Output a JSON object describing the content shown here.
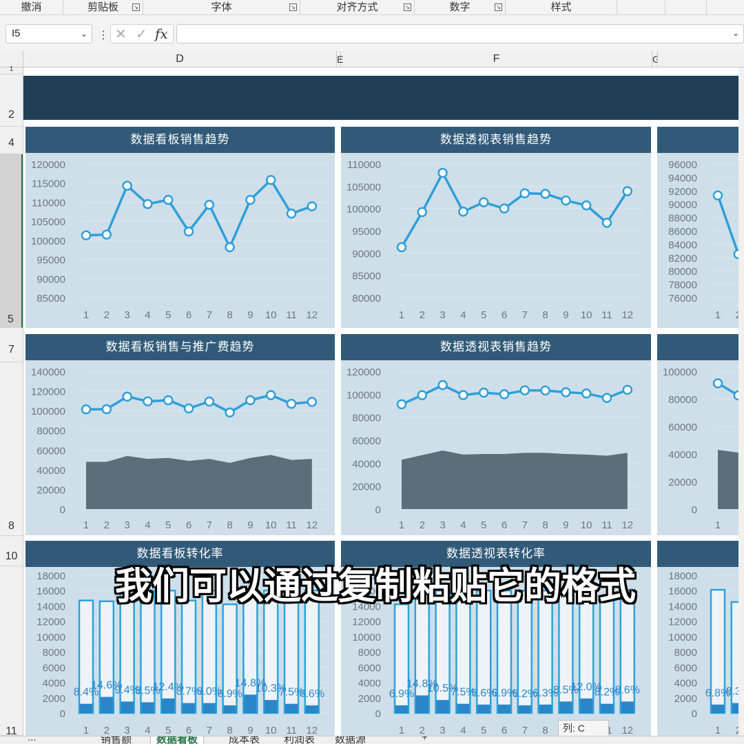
{
  "ribbon": {
    "groups": [
      {
        "label": "撤消",
        "launcher": false
      },
      {
        "label": "剪贴板",
        "launcher": true
      },
      {
        "label": "字体",
        "launcher": true
      },
      {
        "label": "对齐方式",
        "launcher": true
      },
      {
        "label": "数字",
        "launcher": true
      },
      {
        "label": "样式",
        "launcher": false
      }
    ]
  },
  "formula_bar": {
    "name_box": "I5",
    "cancel_icon": "✕",
    "enter_icon": "✓",
    "fx_label": "fx",
    "formula": ""
  },
  "columns": [
    "D",
    "E",
    "F",
    "G"
  ],
  "rows": [
    "1",
    "2",
    "4",
    "5",
    "7",
    "8",
    "10",
    "11"
  ],
  "caption": "我们可以通过复制粘贴它的格式",
  "tooltip": "列: C",
  "sheet_tabs": [
    "...",
    "销售额",
    "数据看板",
    "成本表",
    "利润表",
    "数据源",
    "+"
  ],
  "colors": {
    "banner": "#213f57",
    "panel_title_bg": "#305a78",
    "panel_bg": "#cfdfea",
    "line": "#2e9fd8",
    "area": "#5c6e7a",
    "bar": "#2b86c8"
  },
  "chart_data": [
    {
      "type": "line",
      "title": "数据看板销售趋势",
      "x": [
        1,
        2,
        3,
        4,
        5,
        6,
        7,
        8,
        9,
        10,
        11,
        12
      ],
      "values": [
        101300,
        101500,
        114300,
        109500,
        110600,
        102300,
        109300,
        98200,
        110600,
        115800,
        107000,
        108900
      ],
      "ylim": [
        85000,
        120000
      ],
      "yticks": [
        120000,
        115000,
        110000,
        105000,
        100000,
        95000,
        90000,
        85000
      ]
    },
    {
      "type": "line",
      "title": "数据透视表销售趋势",
      "x": [
        1,
        2,
        3,
        4,
        5,
        6,
        7,
        8,
        9,
        10,
        11,
        12
      ],
      "values": [
        91300,
        99200,
        108000,
        99300,
        101400,
        100000,
        103400,
        103300,
        101800,
        100700,
        96800,
        103900
      ],
      "ylim": [
        80000,
        110000
      ],
      "yticks": [
        110000,
        105000,
        100000,
        95000,
        90000,
        85000,
        80000
      ]
    },
    {
      "type": "line",
      "title": "",
      "x": [
        1,
        2
      ],
      "values": [
        91300,
        82500
      ],
      "ylim": [
        76000,
        96000
      ],
      "yticks": [
        96000,
        94000,
        92000,
        90000,
        88000,
        86000,
        84000,
        82000,
        80000,
        78000,
        76000
      ]
    },
    {
      "type": "line",
      "title": "数据看板销售与推广费趋势",
      "x": [
        1,
        2,
        3,
        4,
        5,
        6,
        7,
        8,
        9,
        10,
        11,
        12
      ],
      "series": [
        {
          "type": "line",
          "values": [
            101300,
            101500,
            114300,
            109500,
            110600,
            102300,
            109300,
            98200,
            110600,
            115800,
            107000,
            108900
          ]
        },
        {
          "type": "area",
          "values": [
            48000,
            48000,
            54000,
            51000,
            52000,
            49000,
            51000,
            47000,
            52000,
            55000,
            50000,
            51000
          ]
        }
      ],
      "ylim": [
        0,
        140000
      ],
      "yticks": [
        140000,
        120000,
        100000,
        80000,
        60000,
        40000,
        20000,
        0
      ]
    },
    {
      "type": "line",
      "title": "数据透视表销售趋势",
      "x": [
        1,
        2,
        3,
        4,
        5,
        6,
        7,
        8,
        9,
        10,
        11,
        12
      ],
      "series": [
        {
          "type": "line",
          "values": [
            91300,
            99200,
            108000,
            99300,
            101400,
            100000,
            103400,
            103300,
            101800,
            100700,
            96800,
            103900
          ]
        },
        {
          "type": "area",
          "values": [
            43000,
            47000,
            51000,
            47500,
            48000,
            48000,
            49000,
            49000,
            48000,
            47500,
            46500,
            49000
          ]
        }
      ],
      "ylim": [
        0,
        120000
      ],
      "yticks": [
        120000,
        100000,
        80000,
        60000,
        40000,
        20000,
        0
      ]
    },
    {
      "type": "line",
      "title": "",
      "x": [
        1
      ],
      "series": [
        {
          "type": "line",
          "values": [
            91300,
            82500
          ]
        },
        {
          "type": "area",
          "values": [
            43000,
            41000
          ]
        }
      ],
      "ylim": [
        0,
        100000
      ],
      "yticks": [
        100000,
        80000,
        60000,
        40000,
        20000,
        0
      ]
    },
    {
      "type": "bar",
      "title": "数据看板转化率",
      "x": [
        1,
        2,
        3,
        4,
        5,
        6,
        7,
        8,
        9,
        10,
        11,
        12
      ],
      "totals": [
        14700,
        14600,
        16000,
        16000,
        16000,
        14700,
        16000,
        14200,
        16000,
        16000,
        14800,
        16000
      ],
      "values": [
        1200,
        2100,
        1500,
        1400,
        1900,
        1300,
        1300,
        1000,
        2400,
        1700,
        1200,
        1000
      ],
      "labels": [
        "8.4%",
        "14.6%",
        "9.4%",
        "8.5%",
        "12.4%",
        "8.7%",
        "8.0%",
        "6.9%",
        "14.8%",
        "10.3%",
        "7.5%",
        "6.6%"
      ],
      "ylim": [
        0,
        18000
      ],
      "yticks": [
        18000,
        16000,
        14000,
        12000,
        10000,
        8000,
        6000,
        4000,
        2000,
        0
      ]
    },
    {
      "type": "bar",
      "title": "数据透视表转化率",
      "x": [
        1,
        2,
        3,
        4,
        5,
        6,
        7,
        8,
        9,
        10,
        11,
        12
      ],
      "totals": [
        14200,
        16000,
        16000,
        16000,
        16000,
        16000,
        16000,
        16000,
        16000,
        16000,
        15000,
        16000
      ],
      "values": [
        1000,
        2300,
        1700,
        1200,
        1100,
        1100,
        1000,
        1100,
        1500,
        1900,
        1200,
        1500
      ],
      "labels": [
        "6.9%",
        "14.8%",
        "10.5%",
        "7.5%",
        "6.6%",
        "6.9%",
        "6.2%",
        "6.3%",
        "8.5%",
        "12.0%",
        "8.2%",
        "8.6%"
      ],
      "ylim": [
        0,
        18000
      ],
      "yticks": [
        18000,
        16000,
        14000,
        12000,
        10000,
        8000,
        6000,
        4000,
        2000,
        0
      ]
    },
    {
      "type": "bar",
      "title": "",
      "x": [
        1,
        2
      ],
      "totals": [
        16100,
        14500
      ],
      "values": [
        1100,
        1300
      ],
      "labels": [
        "6.8%",
        "8.3%"
      ],
      "ylim": [
        0,
        18000
      ],
      "yticks": [
        18000,
        16000,
        14000,
        12000,
        10000,
        8000,
        6000,
        4000,
        2000,
        0
      ]
    }
  ]
}
